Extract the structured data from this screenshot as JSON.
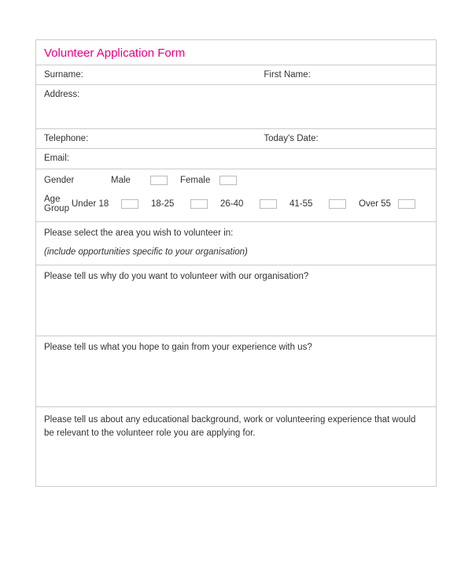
{
  "title": "Volunteer Application Form",
  "fields": {
    "surname": "Surname:",
    "firstname": "First Name:",
    "address": "Address:",
    "telephone": "Telephone:",
    "todaysdate": "Today's Date:",
    "email": "Email:"
  },
  "gender": {
    "label": "Gender",
    "options": [
      "Male",
      "Female"
    ]
  },
  "agegroup": {
    "label": "Age Group",
    "options": [
      "Under 18",
      "18-25",
      "26-40",
      "41-55",
      "Over 55"
    ]
  },
  "area": {
    "question": "Please select the area you wish to volunteer in:",
    "instruction": "(include opportunities specific to your organisation)"
  },
  "q_why": "Please tell us why do you want to volunteer with our organisation?",
  "q_gain": "Please tell us what you hope to gain from your experience with us?",
  "q_background": "Please tell us about any educational background, work or volunteering experience that would be relevant to the volunteer role you are applying for."
}
